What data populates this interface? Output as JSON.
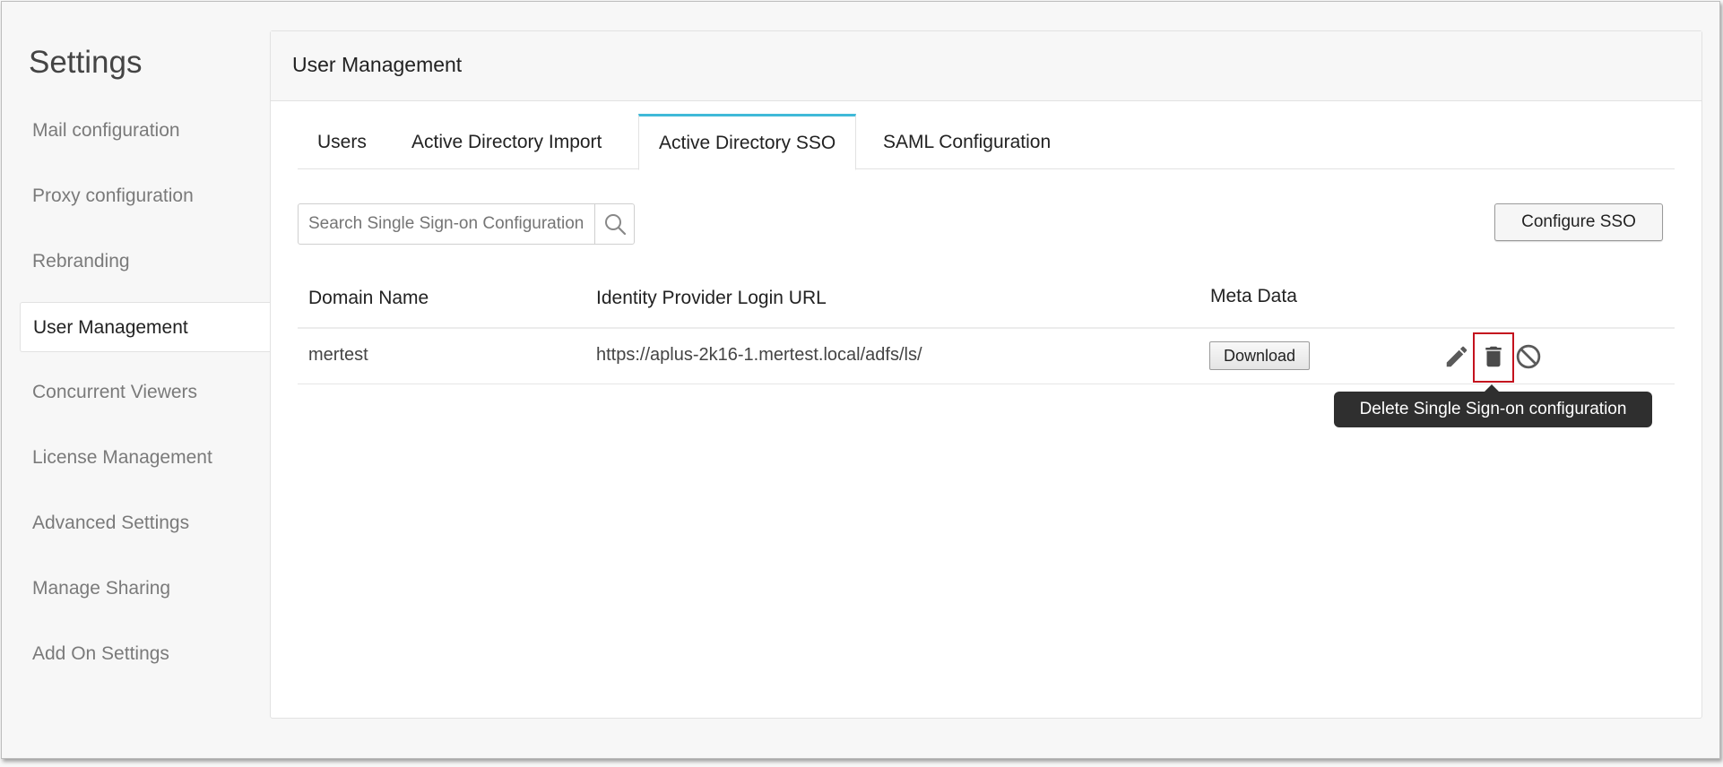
{
  "sidebar": {
    "title": "Settings",
    "items": [
      {
        "label": "Mail configuration"
      },
      {
        "label": "Proxy configuration"
      },
      {
        "label": "Rebranding"
      },
      {
        "label": "User Management"
      },
      {
        "label": "Concurrent Viewers"
      },
      {
        "label": "License Management"
      },
      {
        "label": "Advanced Settings"
      },
      {
        "label": "Manage Sharing"
      },
      {
        "label": "Add On Settings"
      }
    ],
    "active": "User Management"
  },
  "main": {
    "title": "User Management",
    "tabs": [
      {
        "label": "Users"
      },
      {
        "label": "Active Directory Import"
      },
      {
        "label": "Active Directory SSO"
      },
      {
        "label": "SAML Configuration"
      }
    ],
    "active_tab": "Active Directory SSO",
    "search": {
      "placeholder": "Search Single Sign-on Configuration",
      "value": ""
    },
    "configure_button": "Configure SSO",
    "table": {
      "columns": [
        "Domain Name",
        "Identity Provider Login URL",
        "Meta Data"
      ],
      "rows": [
        {
          "domain": "mertest",
          "url": "https://aplus-2k16-1.mertest.local/adfs/ls/",
          "meta_button": "Download",
          "actions": [
            "edit-icon",
            "trash-icon",
            "disable-icon"
          ]
        }
      ]
    },
    "tooltip": "Delete Single Sign-on configuration",
    "colors": {
      "tab_accent": "#3fb9d8",
      "highlight": "#c4121e",
      "tooltip_bg": "#2f2f2f"
    }
  }
}
